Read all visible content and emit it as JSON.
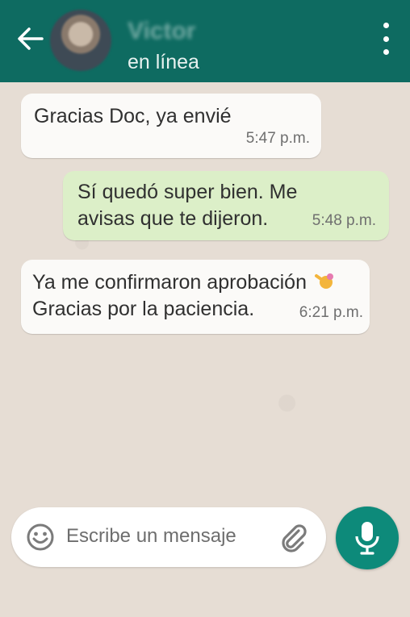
{
  "header": {
    "contact_name": "Victor",
    "status": "en línea"
  },
  "messages": [
    {
      "direction": "incoming",
      "text": "Gracias Doc, ya envié",
      "time": "5:47 p.m."
    },
    {
      "direction": "outgoing",
      "text_lines": [
        "Sí quedó super bien. Me",
        "avisas que te dijeron."
      ],
      "time": "5:48 p.m."
    },
    {
      "direction": "incoming",
      "text_lines": [
        "Ya me confirmaron aprobación",
        "Gracias por la paciencia."
      ],
      "emoji": "hand-icon",
      "time": "6:21 p.m."
    }
  ],
  "composer": {
    "placeholder": "Escribe un mensaje"
  },
  "icons": {
    "back": "arrow-left-icon",
    "menu": "more-vertical-icon",
    "emoji": "smiley-icon",
    "attach": "paperclip-icon",
    "mic": "microphone-icon"
  },
  "colors": {
    "header": "#0e6b61",
    "outgoing_bubble": "#dcefc8",
    "incoming_bubble": "#fbfaf8",
    "mic_button": "#0d8a7a"
  }
}
